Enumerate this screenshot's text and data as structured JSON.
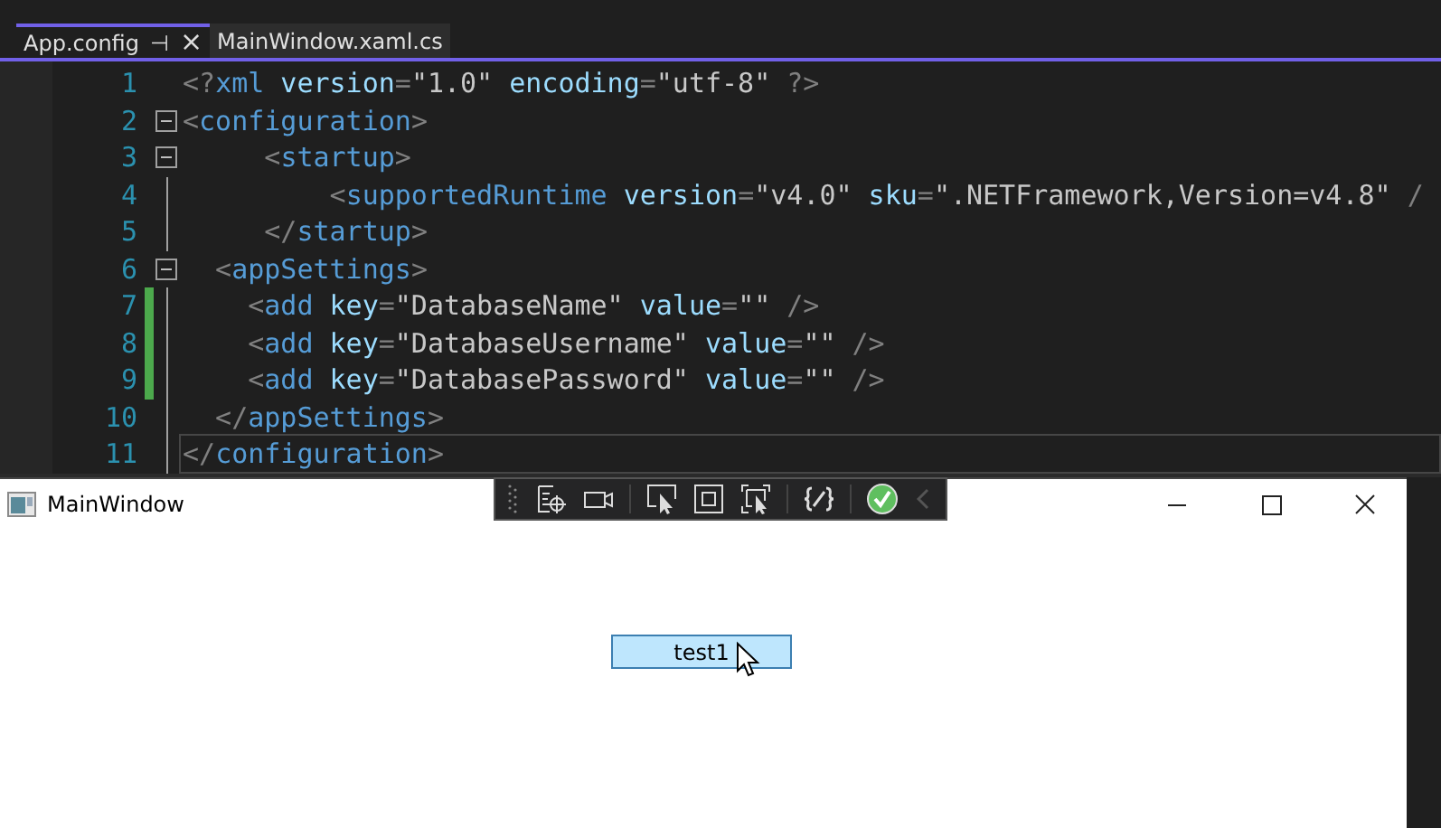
{
  "editor": {
    "tabs": [
      {
        "label": "App.config",
        "selected": true,
        "pin": "⊣",
        "close": "×"
      },
      {
        "label": "MainWindow.xaml.cs",
        "selected": false
      }
    ],
    "lines": [
      {
        "number": "1",
        "foldable": false,
        "changed": false,
        "current": false,
        "tokens": [
          {
            "kind": "punct",
            "text": "<?"
          },
          {
            "kind": "tag",
            "text": "xml"
          },
          {
            "kind": "attr",
            "text": " version"
          },
          {
            "kind": "punct",
            "text": "="
          },
          {
            "kind": "value",
            "text": "\"1.0\""
          },
          {
            "kind": "attr",
            "text": " encoding"
          },
          {
            "kind": "punct",
            "text": "="
          },
          {
            "kind": "value",
            "text": "\"utf-8\""
          },
          {
            "kind": "punct",
            "text": " ?>"
          }
        ]
      },
      {
        "number": "2",
        "foldable": true,
        "changed": false,
        "current": false,
        "tokens": [
          {
            "kind": "punct",
            "text": "<"
          },
          {
            "kind": "tag",
            "text": "configuration"
          },
          {
            "kind": "punct",
            "text": ">"
          }
        ]
      },
      {
        "number": "3",
        "foldable": true,
        "changed": false,
        "current": false,
        "tokens": [
          {
            "kind": "punct",
            "text": "     <"
          },
          {
            "kind": "tag",
            "text": "startup"
          },
          {
            "kind": "punct",
            "text": ">"
          }
        ]
      },
      {
        "number": "4",
        "foldable": false,
        "changed": false,
        "current": false,
        "tokens": [
          {
            "kind": "punct",
            "text": "         <"
          },
          {
            "kind": "tag",
            "text": "supportedRuntime"
          },
          {
            "kind": "attr",
            "text": " version"
          },
          {
            "kind": "punct",
            "text": "="
          },
          {
            "kind": "value",
            "text": "\"v4.0\""
          },
          {
            "kind": "attr",
            "text": " sku"
          },
          {
            "kind": "punct",
            "text": "="
          },
          {
            "kind": "value",
            "text": "\".NETFramework,Version=v4.8\""
          },
          {
            "kind": "punct",
            "text": " /"
          }
        ]
      },
      {
        "number": "5",
        "foldable": false,
        "changed": false,
        "current": false,
        "tokens": [
          {
            "kind": "punct",
            "text": "     </"
          },
          {
            "kind": "tag",
            "text": "startup"
          },
          {
            "kind": "punct",
            "text": ">"
          }
        ]
      },
      {
        "number": "6",
        "foldable": true,
        "changed": false,
        "current": false,
        "tokens": [
          {
            "kind": "punct",
            "text": "  <"
          },
          {
            "kind": "tag",
            "text": "appSettings"
          },
          {
            "kind": "punct",
            "text": ">"
          }
        ]
      },
      {
        "number": "7",
        "foldable": false,
        "changed": true,
        "current": false,
        "tokens": [
          {
            "kind": "punct",
            "text": "    <"
          },
          {
            "kind": "tag",
            "text": "add"
          },
          {
            "kind": "attr",
            "text": " key"
          },
          {
            "kind": "punct",
            "text": "="
          },
          {
            "kind": "value",
            "text": "\"DatabaseName\""
          },
          {
            "kind": "attr",
            "text": " value"
          },
          {
            "kind": "punct",
            "text": "="
          },
          {
            "kind": "value",
            "text": "\"\""
          },
          {
            "kind": "punct",
            "text": " />"
          }
        ]
      },
      {
        "number": "8",
        "foldable": false,
        "changed": true,
        "current": false,
        "tokens": [
          {
            "kind": "punct",
            "text": "    <"
          },
          {
            "kind": "tag",
            "text": "add"
          },
          {
            "kind": "attr",
            "text": " key"
          },
          {
            "kind": "punct",
            "text": "="
          },
          {
            "kind": "value",
            "text": "\"DatabaseUsername\""
          },
          {
            "kind": "attr",
            "text": " value"
          },
          {
            "kind": "punct",
            "text": "="
          },
          {
            "kind": "value",
            "text": "\"\""
          },
          {
            "kind": "punct",
            "text": " />"
          }
        ]
      },
      {
        "number": "9",
        "foldable": false,
        "changed": true,
        "current": false,
        "tokens": [
          {
            "kind": "punct",
            "text": "    <"
          },
          {
            "kind": "tag",
            "text": "add"
          },
          {
            "kind": "attr",
            "text": " key"
          },
          {
            "kind": "punct",
            "text": "="
          },
          {
            "kind": "value",
            "text": "\"DatabasePassword\""
          },
          {
            "kind": "attr",
            "text": " value"
          },
          {
            "kind": "punct",
            "text": "="
          },
          {
            "kind": "value",
            "text": "\"\""
          },
          {
            "kind": "punct",
            "text": " />"
          }
        ]
      },
      {
        "number": "10",
        "foldable": false,
        "changed": false,
        "current": false,
        "tokens": [
          {
            "kind": "punct",
            "text": "  </"
          },
          {
            "kind": "tag",
            "text": "appSettings"
          },
          {
            "kind": "punct",
            "text": ">"
          }
        ]
      },
      {
        "number": "11",
        "foldable": false,
        "changed": false,
        "current": true,
        "tokens": [
          {
            "kind": "punct",
            "text": "</"
          },
          {
            "kind": "tag",
            "text": "configuration"
          },
          {
            "kind": "punct",
            "text": ">"
          }
        ]
      }
    ]
  },
  "window": {
    "title": "MainWindow",
    "button": {
      "label": "test1"
    }
  }
}
